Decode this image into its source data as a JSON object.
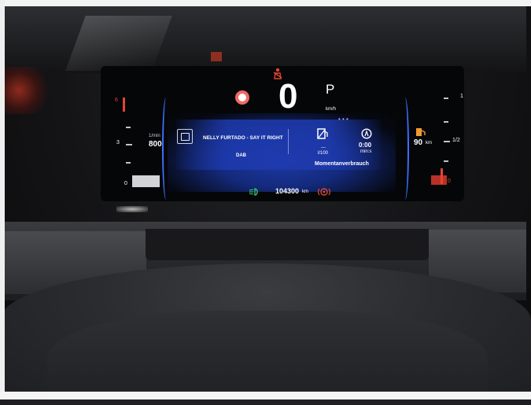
{
  "display": {
    "seatbelt_icon": "seatbelt-warning-icon",
    "speed": "0",
    "speed_unit": "km/h",
    "gear": "P",
    "rpm_unit": "1/min",
    "rpm_value": "800",
    "rpm_ticks": {
      "top": "6",
      "mid": "3",
      "bottom": "0"
    },
    "media": {
      "icon": "radio-icon",
      "title": "NELLY FURTADO - SAY IT RIGHT",
      "source": "DAB"
    },
    "consumption": {
      "icon": "fuel-pump-icon",
      "value": "---",
      "unit": "l/100",
      "label": "Momentanverbrauch"
    },
    "timer": {
      "icon": "timer-icon",
      "value": "0:00",
      "unit": "min:s"
    },
    "range": {
      "icon": "fuel-icon",
      "value": "90",
      "unit": "km"
    },
    "fuel_ticks": {
      "top": "1",
      "mid": "1/2",
      "bottom": "0"
    },
    "odometer": {
      "value": "104300",
      "unit": "km"
    },
    "lights_icon": "low-beam-headlight-icon",
    "brake_icon": "parking-brake-warning-icon",
    "colors": {
      "accent_blue": "#1e3aae",
      "warning_red": "#e2462e",
      "light_green": "#3ed36a"
    }
  }
}
